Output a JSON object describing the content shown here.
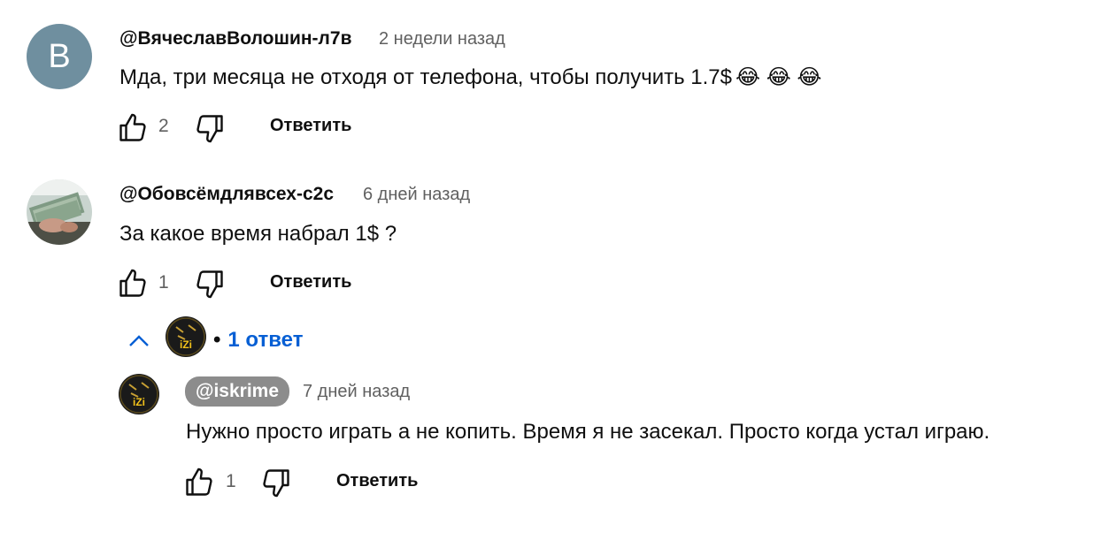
{
  "comments": [
    {
      "avatar_letter": "В",
      "author": "@ВячеславВолошин-л7в",
      "time": "2 недели назад",
      "text": "Мда, три месяца не отходя от телефона, чтобы получить 1.7$",
      "emoji": "😂 😂 😂",
      "likes": "2",
      "reply_label": "Ответить"
    },
    {
      "author": "@Обовсёмдлявсех-с2с",
      "time": "6 дней назад",
      "text": "За какое время набрал 1$ ?",
      "likes": "1",
      "reply_label": "Ответить",
      "replies_toggle": {
        "bullet": "•",
        "label": "1 ответ"
      }
    }
  ],
  "reply": {
    "author": "@iskrime",
    "time": "7 дней назад",
    "text": "Нужно просто играть а не копить. Время я не засекал. Просто когда устал играю.",
    "likes": "1",
    "reply_label": "Ответить",
    "avatar_text": "iZi"
  },
  "colors": {
    "accent": "#065fd4",
    "meta": "#606060",
    "text": "#0f0f0f"
  },
  "icons": [
    "thumb-up-icon",
    "thumb-down-icon",
    "chevron-up-icon"
  ]
}
